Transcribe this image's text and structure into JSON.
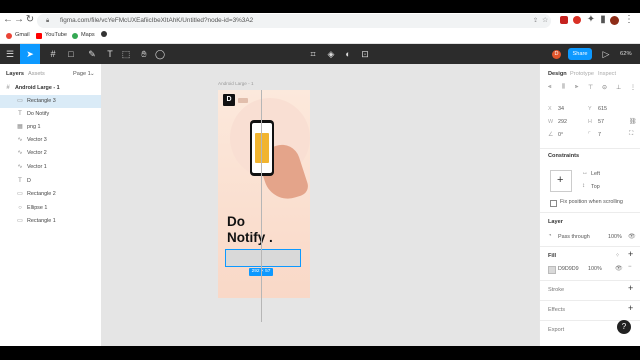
{
  "browser": {
    "url": "figma.com/file/vcYeFMcUXEafiicIbeXItAhK/Untitled?node-id=3%3A2",
    "bookmarks": [
      {
        "label": "Gmail",
        "color": "#ea4335"
      },
      {
        "label": "YouTube",
        "color": "#ff0000"
      },
      {
        "label": "Maps",
        "color": "#34a853"
      }
    ]
  },
  "toolbar": {
    "share_label": "Share",
    "avatar_letter": "D",
    "zoom": "62%"
  },
  "left_panel": {
    "tabs": [
      "Layers",
      "Assets"
    ],
    "page_select": "Page 1",
    "frame_name": "Android Large - 1",
    "layers": [
      {
        "icon": "rect",
        "label": "Rectangle 3",
        "selected": true
      },
      {
        "icon": "text",
        "label": "Do Notify",
        "selected": false
      },
      {
        "icon": "image",
        "label": "png 1",
        "selected": false
      },
      {
        "icon": "vector",
        "label": "Vector 3",
        "selected": false
      },
      {
        "icon": "vector",
        "label": "Vector 2",
        "selected": false
      },
      {
        "icon": "vector",
        "label": "Vector 1",
        "selected": false
      },
      {
        "icon": "text",
        "label": "D",
        "selected": false
      },
      {
        "icon": "rect",
        "label": "Rectangle 2",
        "selected": false
      },
      {
        "icon": "ellipse",
        "label": "Ellipse 1",
        "selected": false
      },
      {
        "icon": "rect",
        "label": "Rectangle 1",
        "selected": false
      }
    ]
  },
  "canvas": {
    "frame_title": "Android Large - 1",
    "logo_letter": "D",
    "headline": "Do\nNotify .",
    "dimension_badge": "292 × 57",
    "accent": "#0d99ff"
  },
  "right_panel": {
    "tabs": [
      "Design",
      "Prototype",
      "Inspect"
    ],
    "x_label": "X",
    "x_value": "34",
    "y_label": "Y",
    "y_value": "615",
    "w_label": "W",
    "w_value": "292",
    "h_label": "H",
    "h_value": "57",
    "rotation_value": "0°",
    "radius_value": "7",
    "constraints_heading": "Constraints",
    "constraint_h": "Left",
    "constraint_v": "Top",
    "fix_position_label": "Fix position when scrolling",
    "layer_heading": "Layer",
    "blend_mode": "Pass through",
    "layer_opacity": "100%",
    "fill_heading": "Fill",
    "fill_hex": "D9D9D9",
    "fill_color": "#d9d9d9",
    "fill_opacity": "100%",
    "stroke_heading": "Stroke",
    "effects_heading": "Effects",
    "export_heading": "Export",
    "help_label": "?"
  }
}
